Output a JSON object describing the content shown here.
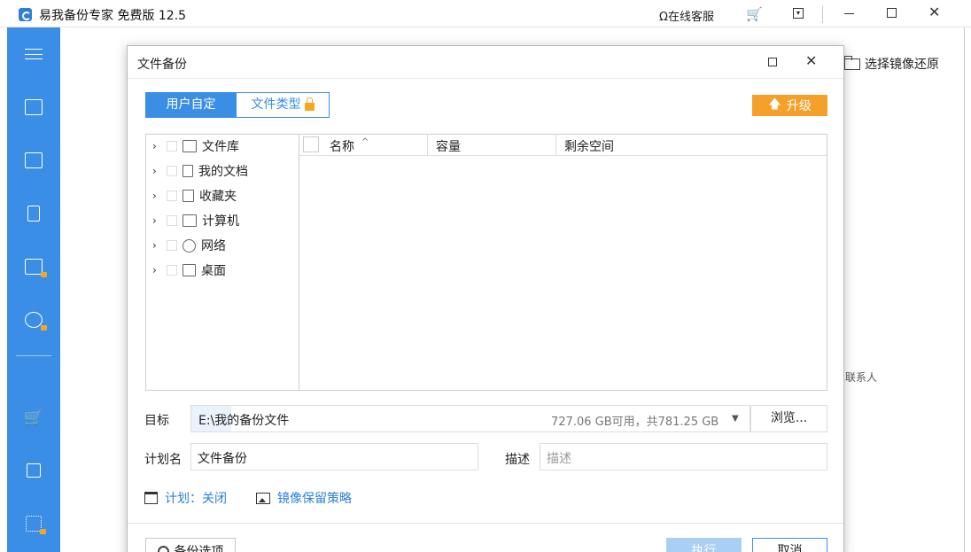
{
  "app": {
    "title": "易我备份专家 免费版 12.5",
    "service_label": "在线客服"
  },
  "background": {
    "restore_label": "选择镜像还原",
    "contact_label": "联系人"
  },
  "dialog": {
    "title": "文件备份",
    "tabs": [
      {
        "label": "用户自定义",
        "active": true
      },
      {
        "label": "文件类型",
        "active": false
      }
    ],
    "upgrade_label": "升级",
    "tree": [
      {
        "label": "文件库",
        "icon": "folder-icon"
      },
      {
        "label": "我的文档",
        "icon": "document-icon"
      },
      {
        "label": "收藏夹",
        "icon": "favorites-icon"
      },
      {
        "label": "计算机",
        "icon": "computer-icon"
      },
      {
        "label": "网络",
        "icon": "network-icon"
      },
      {
        "label": "桌面",
        "icon": "desktop-icon"
      }
    ],
    "list_columns": [
      "名称",
      "容量",
      "剩余空间"
    ],
    "target": {
      "label": "目标",
      "path": "E:\\我的备份文件",
      "space": "727.06 GB可用，共781.25 GB",
      "browse_label": "浏览..."
    },
    "plan": {
      "label": "计划名",
      "value": "文件备份"
    },
    "description": {
      "label": "描述",
      "placeholder": "描述"
    },
    "schedule_link": "计划：关闭",
    "retention_link": "镜像保留策略",
    "options_button": "备份选项",
    "execute_button": "执行",
    "cancel_button": "取消"
  },
  "colors": {
    "accent": "#3a8ee6",
    "sidebar": "#3a8ee6",
    "upgrade": "#f5a02a",
    "link": "#2b7fd8"
  }
}
